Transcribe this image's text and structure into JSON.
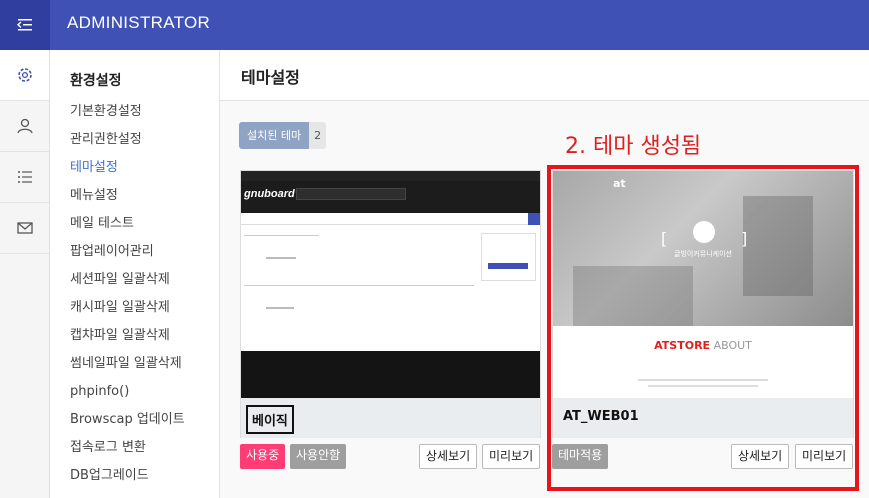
{
  "topbar": {
    "brand": "ADMINISTRATOR",
    "toggle_icon": "menu-collapse-icon"
  },
  "iconbar": {
    "items": [
      "gear-icon",
      "user-icon",
      "list-icon",
      "mail-icon"
    ]
  },
  "subnav": {
    "title": "환경설정",
    "items": [
      {
        "label": "기본환경설정"
      },
      {
        "label": "관리권한설정"
      },
      {
        "label": "테마설정",
        "active": true
      },
      {
        "label": "메뉴설정"
      },
      {
        "label": "메일 테스트"
      },
      {
        "label": "팝업레이어관리"
      },
      {
        "label": "세션파일 일괄삭제"
      },
      {
        "label": "캐시파일 일괄삭제"
      },
      {
        "label": "캡챠파일 일괄삭제"
      },
      {
        "label": "썸네일파일 일괄삭제"
      },
      {
        "label": "phpinfo()"
      },
      {
        "label": "Browscap 업데이트"
      },
      {
        "label": "접속로그 변환"
      },
      {
        "label": "DB업그레이드"
      }
    ]
  },
  "page": {
    "title": "테마설정",
    "installed_label": "설치된 테마",
    "installed_count": "2",
    "annotation": "2. 테마 생성됨"
  },
  "themes": [
    {
      "name": "베이직",
      "buttons": {
        "in_use": "사용중",
        "not_use": "사용안함",
        "detail": "상세보기",
        "preview": "미리보기"
      },
      "thumb": {
        "logo": "gnuboard"
      }
    },
    {
      "name": "AT_WEB01",
      "buttons": {
        "apply": "테마적용",
        "detail": "상세보기",
        "preview": "미리보기"
      },
      "thumb": {
        "logo": "at",
        "hero_text": "글빙이커뮤니케이션",
        "about_red": "ATSTORE",
        "about_gray": "ABOUT"
      }
    }
  ],
  "colors": {
    "topbar": "#3f51b5",
    "accent_active": "#3f6fd8",
    "in_use": "#ff3d74",
    "annotation": "#e02020"
  }
}
